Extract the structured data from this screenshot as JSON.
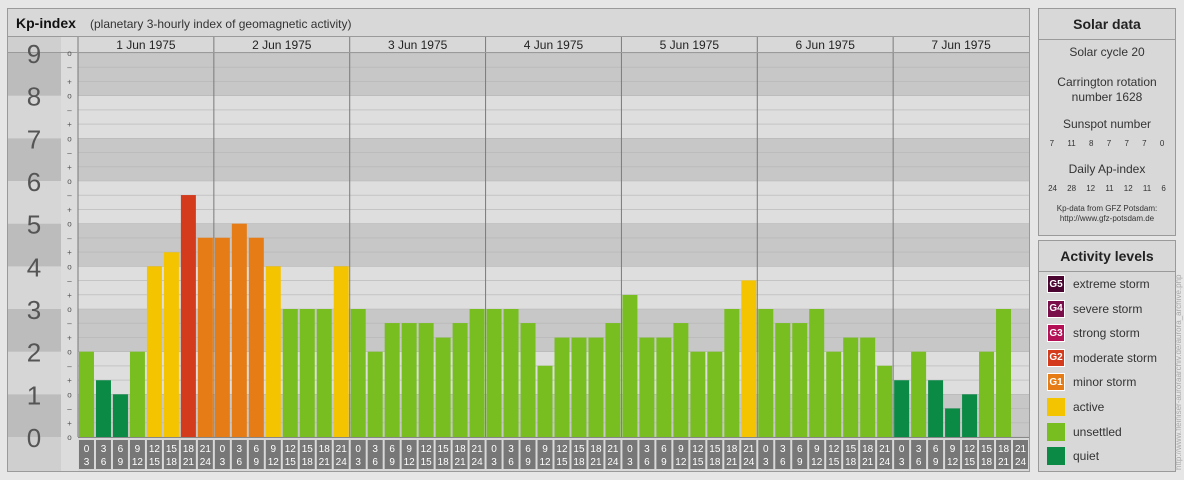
{
  "header": {
    "title": "Kp-index",
    "subtitle": "(planetary 3-hourly index of geomagnetic activity)"
  },
  "chart_data": {
    "type": "bar",
    "title": "Kp-index",
    "subtitle": "(planetary 3-hourly index of geomagnetic activity)",
    "ylim": [
      0,
      9
    ],
    "y_ticks": [
      "0",
      "1",
      "2",
      "3",
      "4",
      "5",
      "6",
      "7",
      "8",
      "9"
    ],
    "y_minor_marks": [
      "+",
      "o",
      "–"
    ],
    "days": [
      "1 Jun 1975",
      "2 Jun 1975",
      "3 Jun 1975",
      "4 Jun 1975",
      "5 Jun 1975",
      "6 Jun 1975",
      "7 Jun 1975"
    ],
    "interval_start": [
      "0",
      "3",
      "6",
      "9",
      "12",
      "15",
      "18",
      "21"
    ],
    "interval_end": [
      "3",
      "6",
      "9",
      "12",
      "15",
      "18",
      "21",
      "24"
    ],
    "values": [
      2,
      1.33,
      1,
      2,
      4,
      4.33,
      5.67,
      4.67,
      4.67,
      5,
      4.67,
      4,
      3,
      3,
      3,
      4,
      3,
      2,
      2.67,
      2.67,
      2.67,
      2.33,
      2.67,
      3,
      3,
      3,
      2.67,
      1.67,
      2.33,
      2.33,
      2.33,
      2.67,
      3.33,
      2.33,
      2.33,
      2.67,
      2,
      2,
      3,
      3.67,
      3,
      2.67,
      2.67,
      3,
      2,
      2.33,
      2.33,
      1.67,
      1.33,
      2,
      1.33,
      0.67,
      1,
      2,
      3
    ],
    "grid": true,
    "colors": {
      "quiet": "#0a8a45",
      "unsettled": "#78be21",
      "active": "#f5c400",
      "G1": "#e57c16",
      "G2": "#d43a1c",
      "G3": "#b31055",
      "G4": "#7a0e4a",
      "G5": "#4a0630"
    }
  },
  "solar": {
    "title": "Solar data",
    "cycle": "Solar cycle 20",
    "carrington_line1": "Carrington rotation",
    "carrington_line2": "number 1628",
    "sunspot_label": "Sunspot number",
    "sunspot_values": [
      "7",
      "11",
      "8",
      "7",
      "7",
      "7",
      "0"
    ],
    "ap_label": "Daily Ap-index",
    "ap_values": [
      "24",
      "28",
      "12",
      "11",
      "12",
      "11",
      "6"
    ],
    "credit_line1": "Kp-data from GFZ Potsdam:",
    "credit_line2": "http://www.gfz-potsdam.de"
  },
  "levels": {
    "title": "Activity levels",
    "items": [
      {
        "badge": "G5",
        "label": "extreme storm",
        "color": "#4a0630"
      },
      {
        "badge": "G4",
        "label": "severe storm",
        "color": "#7a0e4a"
      },
      {
        "badge": "G3",
        "label": "strong storm",
        "color": "#b31055"
      },
      {
        "badge": "G2",
        "label": "moderate storm",
        "color": "#d43a1c"
      },
      {
        "badge": "G1",
        "label": "minor storm",
        "color": "#e57c16"
      },
      {
        "badge": "",
        "label": "active",
        "color": "#f5c400"
      },
      {
        "badge": "",
        "label": "unsettled",
        "color": "#78be21"
      },
      {
        "badge": "",
        "label": "quiet",
        "color": "#0a8a45"
      }
    ]
  },
  "watermark": "http://www.fleiniser-auroraarchiv.de/aurora_archive.php"
}
